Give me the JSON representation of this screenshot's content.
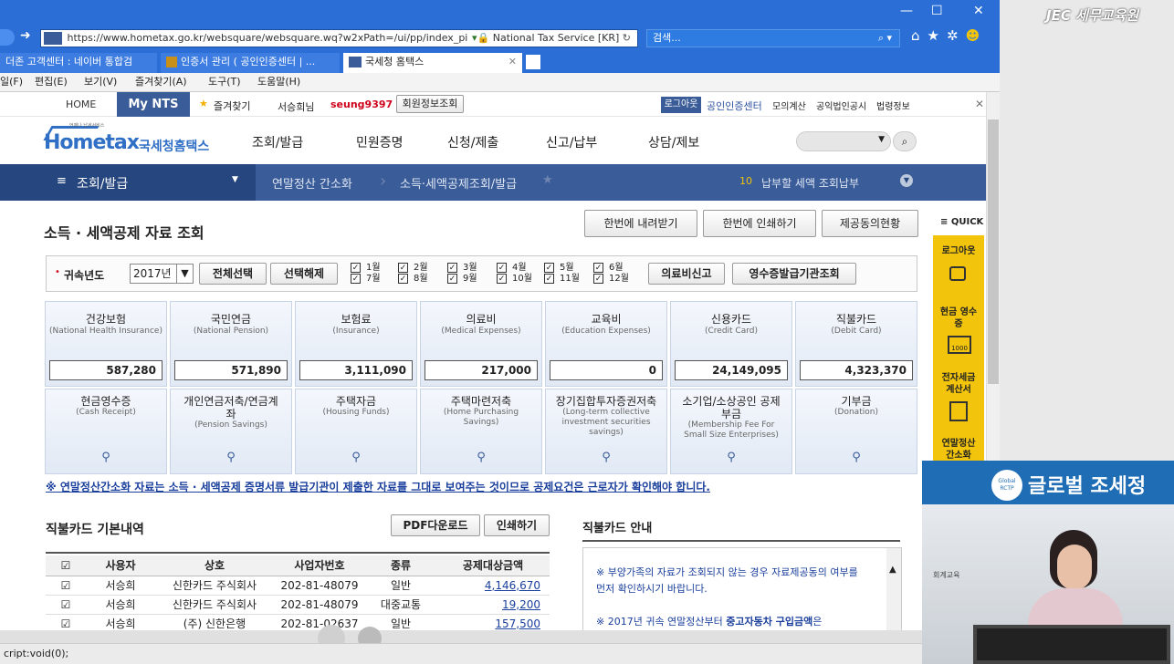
{
  "window": {
    "min": "—",
    "max": "☐",
    "close": "✕"
  },
  "address": {
    "url": "https://www.hometax.go.kr/websquare/websquare.wq?w2xPath=/ui/pp/index_pi",
    "site": "National Tax Service [KR]",
    "search_placeholder": "검색..."
  },
  "tabs": [
    {
      "label": "더존 고객센터 : 네이버 통합검"
    },
    {
      "label": "인증서 관리 ( 공인인증센터 | ..."
    },
    {
      "label": "국세청 홈택스"
    }
  ],
  "menus": [
    "일(F)",
    "편집(E)",
    "보기(V)",
    "즐겨찾기(A)",
    "도구(T)",
    "도움말(H)"
  ],
  "topstrip": {
    "home": "HOME",
    "mynts": "My NTS",
    "favorite": "즐겨찾기",
    "user_prefix": "서승희님",
    "user_id": "seung9397",
    "member_info": "회원정보조회",
    "logout": "로그아웃",
    "cert_center": "공인인증센터",
    "links": [
      "모의계산",
      "공익법인공시",
      "법령정보"
    ]
  },
  "gnb": {
    "logo_small": "언제나 납세서비스",
    "logo": "Hometax",
    "logo_kr": "국세청홈택스",
    "menus": [
      "조회/발급",
      "민원증명",
      "신청/제출",
      "신고/납부",
      "상담/제보"
    ]
  },
  "lnb": {
    "menu": "조회/발급",
    "crumb1": "연말정산 간소화",
    "crumb2": "소득·세액공제조회/발급",
    "badge": "10",
    "right": "납부할 세액 조회납부"
  },
  "content": {
    "title": "소득 · 세액공제 자료 조회",
    "actions": [
      "한번에 내려받기",
      "한번에 인쇄하기",
      "제공동의현황"
    ],
    "year_label": "귀속년도",
    "year": "2017년",
    "select_all": "전체선택",
    "deselect": "선택해제",
    "months": [
      "1월",
      "2월",
      "3월",
      "4월",
      "5월",
      "6월",
      "7월",
      "8월",
      "9월",
      "10월",
      "11월",
      "12월"
    ],
    "med_report": "의료비신고",
    "receipt_org": "영수증발급기관조회",
    "cards_top": [
      {
        "title": "건강보험",
        "sub": "(National Health Insurance)",
        "value": "587,280"
      },
      {
        "title": "국민연금",
        "sub": "(National Pension)",
        "value": "571,890"
      },
      {
        "title": "보험료",
        "sub": "(Insurance)",
        "value": "3,111,090"
      },
      {
        "title": "의료비",
        "sub": "(Medical Expenses)",
        "value": "217,000"
      },
      {
        "title": "교육비",
        "sub": "(Education Expenses)",
        "value": "0"
      },
      {
        "title": "신용카드",
        "sub": "(Credit Card)",
        "value": "24,149,095"
      },
      {
        "title": "직불카드",
        "sub": "(Debit Card)",
        "value": "4,323,370"
      }
    ],
    "cards_bottom": [
      {
        "title": "현금영수증",
        "sub": "(Cash Receipt)"
      },
      {
        "title": "개인연금저축/연금계좌",
        "sub": "(Pension Savings)"
      },
      {
        "title": "주택자금",
        "sub": "(Housing Funds)"
      },
      {
        "title": "주택마련저축",
        "sub": "(Home Purchasing Savings)"
      },
      {
        "title": "장기집합투자증권저축",
        "sub": "(Long-term collective investment securities savings)"
      },
      {
        "title": "소기업/소상공인 공제부금",
        "sub": "(Membership Fee For Small Size Enterprises)"
      },
      {
        "title": "기부금",
        "sub": "(Donation)"
      }
    ],
    "notice": "※ 연말정산간소화 자료는 소득 · 세액공제 증명서류 발급기관이 제출한 자료를 그대로 보여주는 것이므로 공제요건은 근로자가 확인해야 합니다.",
    "debit_title": "직불카드 기본내역",
    "pdf": "PDF다운로드",
    "print": "인쇄하기",
    "table_headers": [
      "사용자",
      "상호",
      "사업자번호",
      "종류",
      "공제대상금액"
    ],
    "rows": [
      [
        "서승희",
        "신한카드 주식회사",
        "202-81-48079",
        "일반",
        "4,146,670"
      ],
      [
        "서승희",
        "신한카드 주식회사",
        "202-81-48079",
        "대중교통",
        "19,200"
      ],
      [
        "서승희",
        "(주) 신한은행",
        "202-81-02637",
        "일반",
        "157,500"
      ]
    ],
    "guide_title": "직불카드 안내",
    "guide1": "※ 부양가족의 자료가 조회되지 않는 경우 자료제공동의 여부를 먼저 확인하시기 바랍니다.",
    "guide2_a": "※ 2017년 귀속 연말정산부터 ",
    "guide2_b": "중고자동차 구입금액",
    "guide2_c": "은"
  },
  "quick": {
    "label": "QUICK",
    "items": [
      "로그아웃",
      "현금 영수증",
      "전자세금 계산서",
      "연말정산 간소화"
    ],
    "badge": "1000"
  },
  "video": {
    "logo": "Global RCTP",
    "title": "글로벌 조세정",
    "side": "회계교육"
  },
  "watermark": "JEC 세무교육원",
  "status": "cript:void(0);"
}
